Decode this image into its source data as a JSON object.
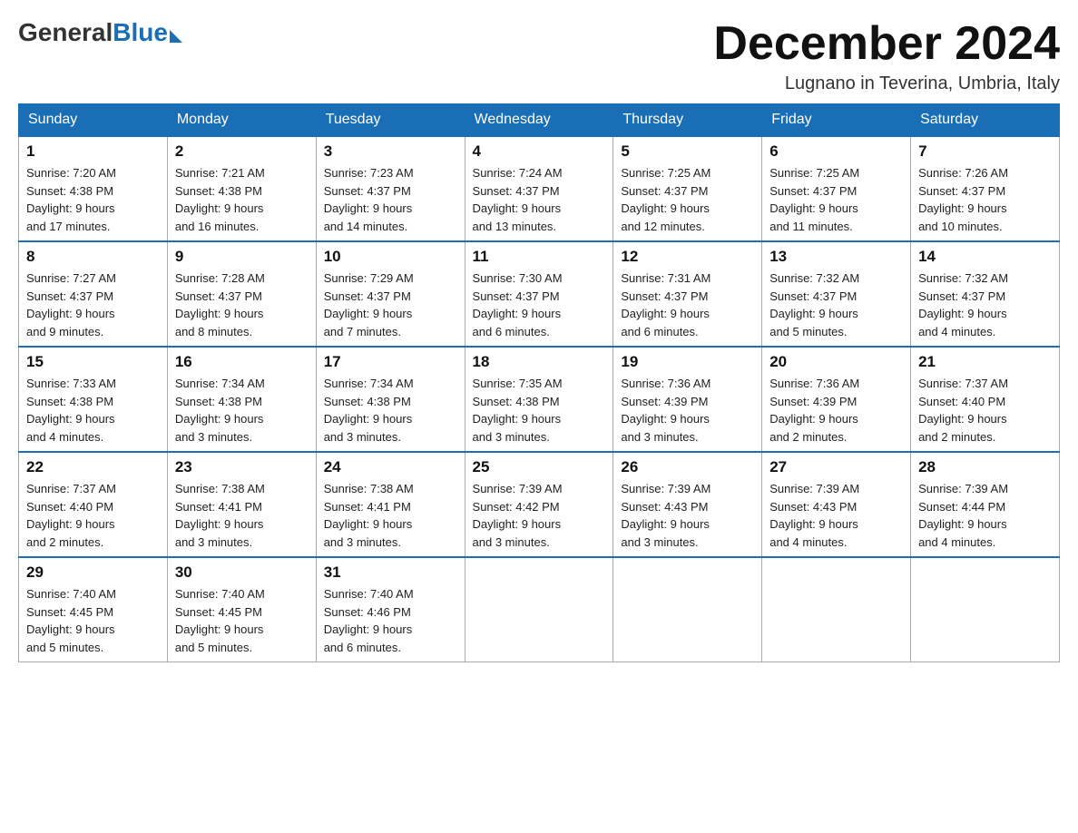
{
  "header": {
    "logo": {
      "general": "General",
      "blue": "Blue"
    },
    "title": "December 2024",
    "location": "Lugnano in Teverina, Umbria, Italy"
  },
  "weekdays": [
    "Sunday",
    "Monday",
    "Tuesday",
    "Wednesday",
    "Thursday",
    "Friday",
    "Saturday"
  ],
  "weeks": [
    [
      {
        "day": "1",
        "sunrise": "7:20 AM",
        "sunset": "4:38 PM",
        "daylight": "9 hours and 17 minutes."
      },
      {
        "day": "2",
        "sunrise": "7:21 AM",
        "sunset": "4:38 PM",
        "daylight": "9 hours and 16 minutes."
      },
      {
        "day": "3",
        "sunrise": "7:23 AM",
        "sunset": "4:37 PM",
        "daylight": "9 hours and 14 minutes."
      },
      {
        "day": "4",
        "sunrise": "7:24 AM",
        "sunset": "4:37 PM",
        "daylight": "9 hours and 13 minutes."
      },
      {
        "day": "5",
        "sunrise": "7:25 AM",
        "sunset": "4:37 PM",
        "daylight": "9 hours and 12 minutes."
      },
      {
        "day": "6",
        "sunrise": "7:25 AM",
        "sunset": "4:37 PM",
        "daylight": "9 hours and 11 minutes."
      },
      {
        "day": "7",
        "sunrise": "7:26 AM",
        "sunset": "4:37 PM",
        "daylight": "9 hours and 10 minutes."
      }
    ],
    [
      {
        "day": "8",
        "sunrise": "7:27 AM",
        "sunset": "4:37 PM",
        "daylight": "9 hours and 9 minutes."
      },
      {
        "day": "9",
        "sunrise": "7:28 AM",
        "sunset": "4:37 PM",
        "daylight": "9 hours and 8 minutes."
      },
      {
        "day": "10",
        "sunrise": "7:29 AM",
        "sunset": "4:37 PM",
        "daylight": "9 hours and 7 minutes."
      },
      {
        "day": "11",
        "sunrise": "7:30 AM",
        "sunset": "4:37 PM",
        "daylight": "9 hours and 6 minutes."
      },
      {
        "day": "12",
        "sunrise": "7:31 AM",
        "sunset": "4:37 PM",
        "daylight": "9 hours and 6 minutes."
      },
      {
        "day": "13",
        "sunrise": "7:32 AM",
        "sunset": "4:37 PM",
        "daylight": "9 hours and 5 minutes."
      },
      {
        "day": "14",
        "sunrise": "7:32 AM",
        "sunset": "4:37 PM",
        "daylight": "9 hours and 4 minutes."
      }
    ],
    [
      {
        "day": "15",
        "sunrise": "7:33 AM",
        "sunset": "4:38 PM",
        "daylight": "9 hours and 4 minutes."
      },
      {
        "day": "16",
        "sunrise": "7:34 AM",
        "sunset": "4:38 PM",
        "daylight": "9 hours and 3 minutes."
      },
      {
        "day": "17",
        "sunrise": "7:34 AM",
        "sunset": "4:38 PM",
        "daylight": "9 hours and 3 minutes."
      },
      {
        "day": "18",
        "sunrise": "7:35 AM",
        "sunset": "4:38 PM",
        "daylight": "9 hours and 3 minutes."
      },
      {
        "day": "19",
        "sunrise": "7:36 AM",
        "sunset": "4:39 PM",
        "daylight": "9 hours and 3 minutes."
      },
      {
        "day": "20",
        "sunrise": "7:36 AM",
        "sunset": "4:39 PM",
        "daylight": "9 hours and 2 minutes."
      },
      {
        "day": "21",
        "sunrise": "7:37 AM",
        "sunset": "4:40 PM",
        "daylight": "9 hours and 2 minutes."
      }
    ],
    [
      {
        "day": "22",
        "sunrise": "7:37 AM",
        "sunset": "4:40 PM",
        "daylight": "9 hours and 2 minutes."
      },
      {
        "day": "23",
        "sunrise": "7:38 AM",
        "sunset": "4:41 PM",
        "daylight": "9 hours and 3 minutes."
      },
      {
        "day": "24",
        "sunrise": "7:38 AM",
        "sunset": "4:41 PM",
        "daylight": "9 hours and 3 minutes."
      },
      {
        "day": "25",
        "sunrise": "7:39 AM",
        "sunset": "4:42 PM",
        "daylight": "9 hours and 3 minutes."
      },
      {
        "day": "26",
        "sunrise": "7:39 AM",
        "sunset": "4:43 PM",
        "daylight": "9 hours and 3 minutes."
      },
      {
        "day": "27",
        "sunrise": "7:39 AM",
        "sunset": "4:43 PM",
        "daylight": "9 hours and 4 minutes."
      },
      {
        "day": "28",
        "sunrise": "7:39 AM",
        "sunset": "4:44 PM",
        "daylight": "9 hours and 4 minutes."
      }
    ],
    [
      {
        "day": "29",
        "sunrise": "7:40 AM",
        "sunset": "4:45 PM",
        "daylight": "9 hours and 5 minutes."
      },
      {
        "day": "30",
        "sunrise": "7:40 AM",
        "sunset": "4:45 PM",
        "daylight": "9 hours and 5 minutes."
      },
      {
        "day": "31",
        "sunrise": "7:40 AM",
        "sunset": "4:46 PM",
        "daylight": "9 hours and 6 minutes."
      },
      null,
      null,
      null,
      null
    ]
  ],
  "labels": {
    "sunrise": "Sunrise:",
    "sunset": "Sunset:",
    "daylight": "Daylight:"
  }
}
